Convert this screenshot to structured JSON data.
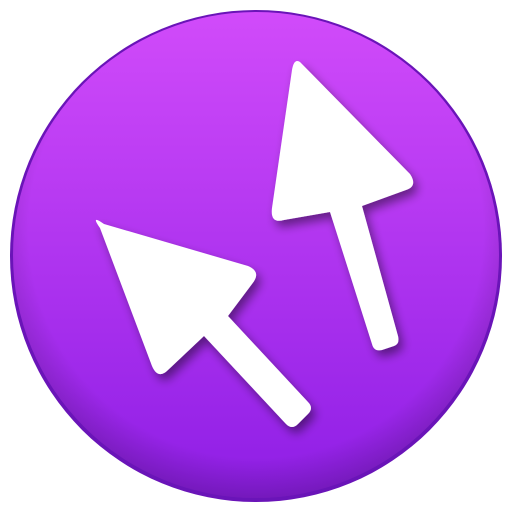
{
  "icon": {
    "description_name": "dual-cursor-app-icon",
    "colors": {
      "circle_top": "#D14BFA",
      "circle_bottom": "#8E1EE5",
      "rim": "#6A14B8",
      "arrow_fill": "#FFFFFF",
      "shadow": "#3E0A6E",
      "background": "#FFFFFF"
    },
    "glyphs": [
      "cursor-arrow-icon",
      "cursor-arrow-icon"
    ]
  }
}
